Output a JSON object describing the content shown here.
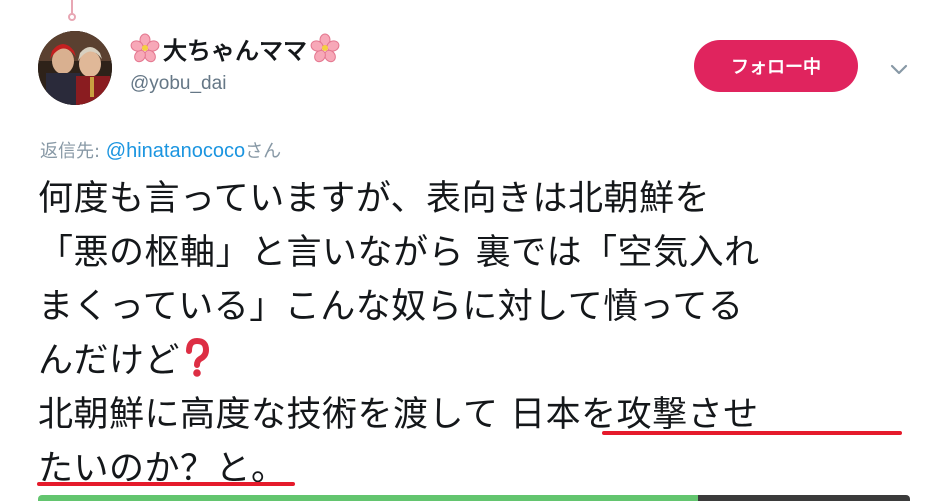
{
  "user": {
    "display_name": "大ちゃんママ",
    "handle": "@yobu_dai"
  },
  "follow_button": {
    "label": "フォロー中",
    "color": "#e0245e"
  },
  "reply": {
    "prefix": "返信先: ",
    "mention": "@hinatanococo",
    "suffix": "さん"
  },
  "tweet": {
    "lines": [
      "何度も言っていますが、表向きは北朝鮮を",
      "「悪の枢軸」と言いながら 裏では「空気入れ",
      "まくっている」こんな奴らに対して憤ってる",
      "んだけど",
      "北朝鮮に高度な技術を渡して 日本を攻撃させ",
      "たいのか？と。"
    ]
  },
  "icons": {
    "flower": "cherry-blossom-icon",
    "question": "red-question-mark-icon",
    "caret": "chevron-down-icon"
  },
  "colors": {
    "accent": "#e0245e",
    "mention": "#1b95e0",
    "underline": "#e51a2b",
    "muted": "#657786"
  }
}
